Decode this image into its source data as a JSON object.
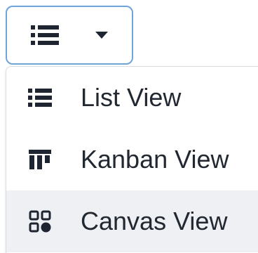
{
  "view_switcher": {
    "current_icon": "list-icon",
    "dropdown_icon": "caret-down-icon"
  },
  "menu": {
    "items": [
      {
        "label": "List View",
        "icon": "list-icon",
        "highlighted": false
      },
      {
        "label": "Kanban View",
        "icon": "kanban-icon",
        "highlighted": false
      },
      {
        "label": "Canvas View",
        "icon": "canvas-icon",
        "highlighted": true
      }
    ]
  },
  "colors": {
    "button_border": "#6fa4d8",
    "icon": "#1f2530",
    "text": "#222831",
    "highlight_bg": "#eef0f3"
  }
}
